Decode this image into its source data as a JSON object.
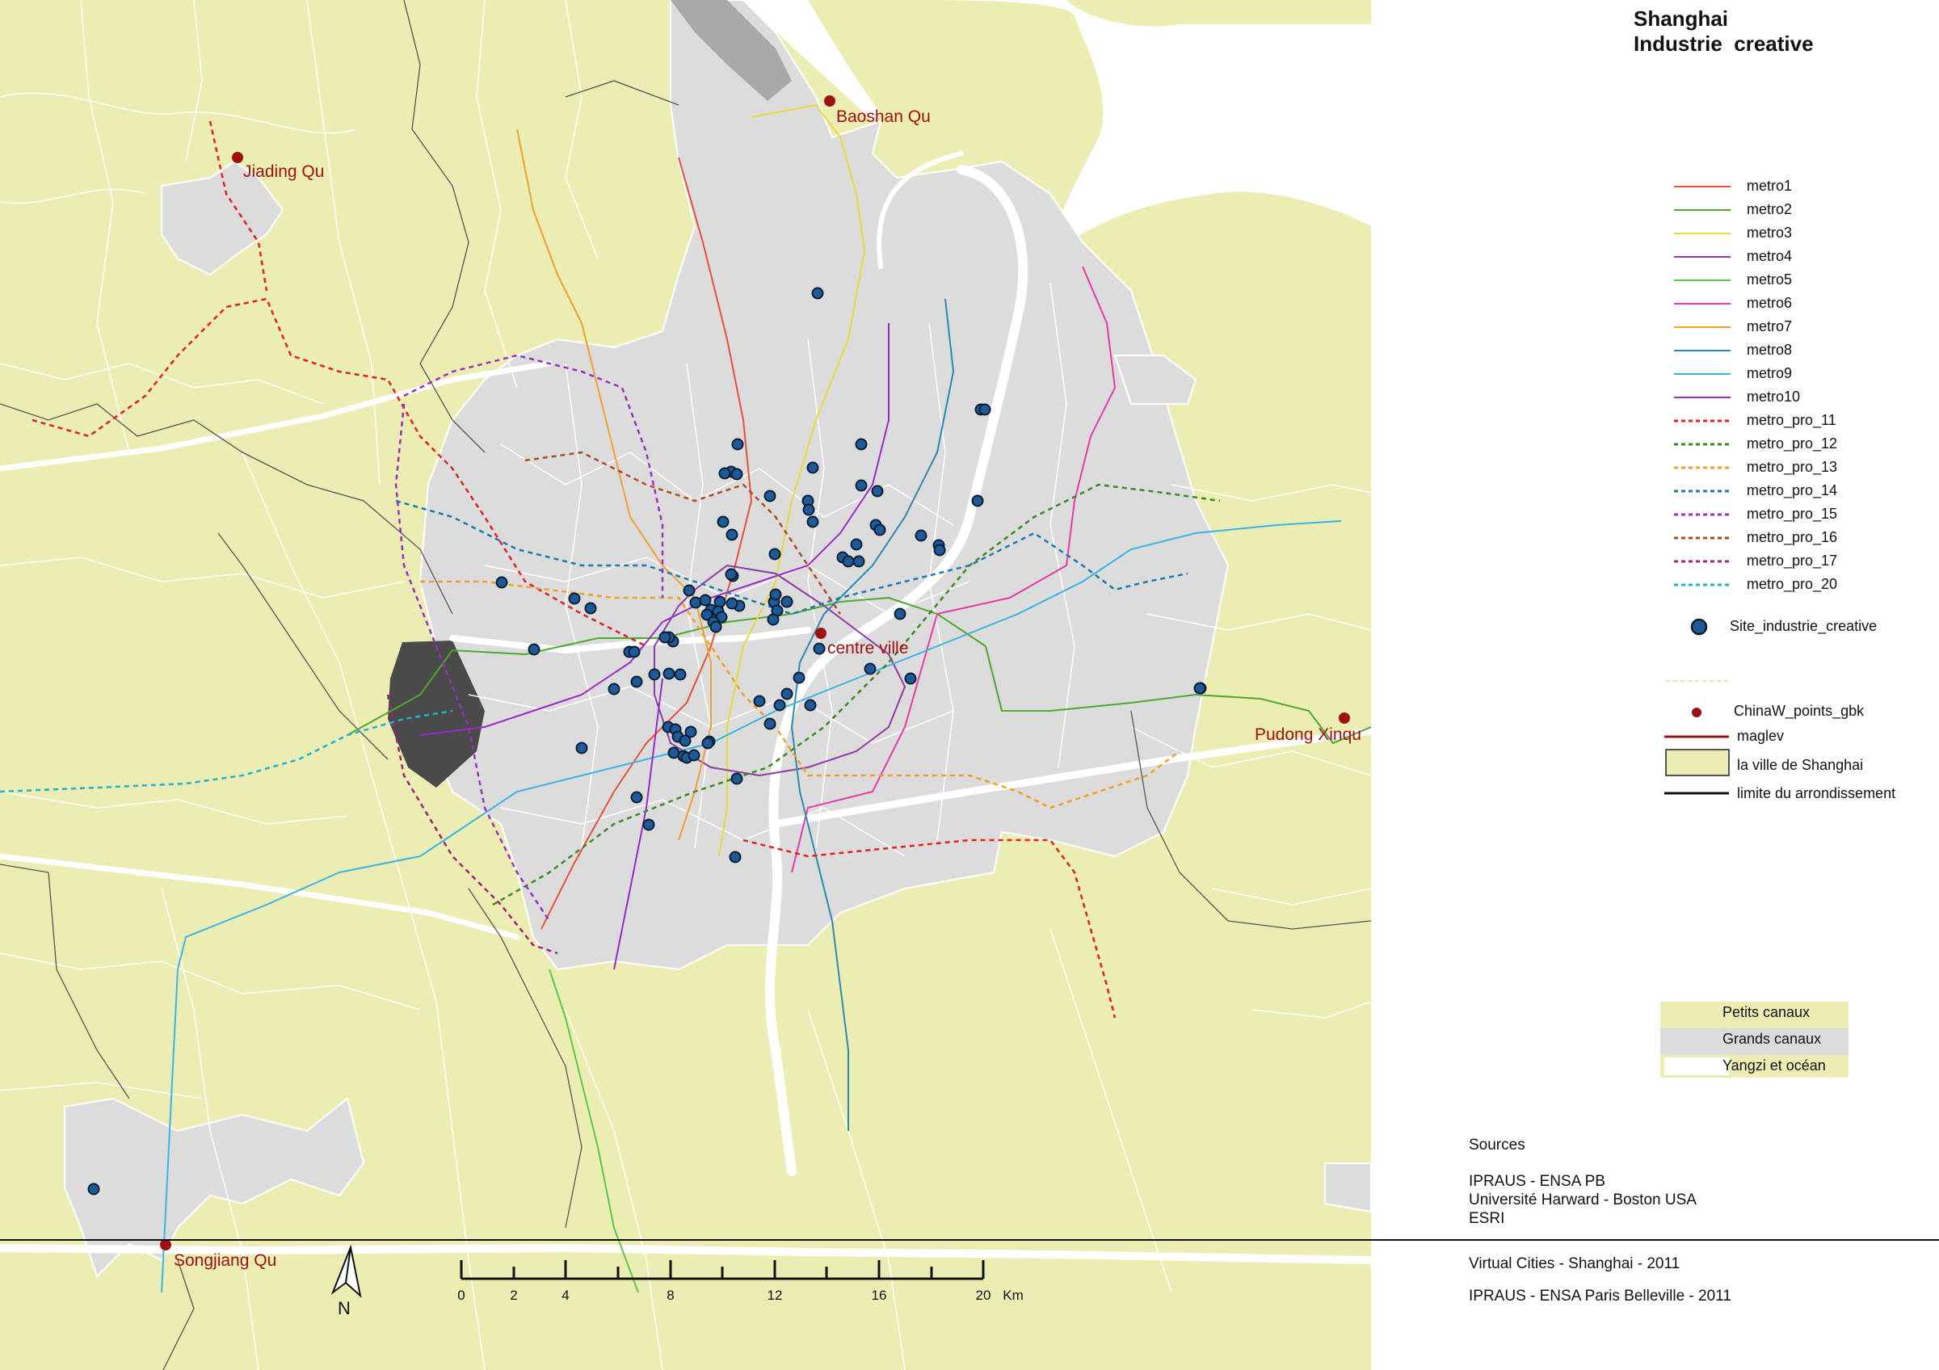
{
  "title": {
    "line1": "Shanghai",
    "line2": "Industrie  creative"
  },
  "places": [
    {
      "name": "Jiading Qu"
    },
    {
      "name": "Baoshan Qu"
    },
    {
      "name": "centre ville"
    },
    {
      "name": "Pudong Xinqu"
    },
    {
      "name": "Songjiang Qu"
    }
  ],
  "legend": {
    "lines": [
      {
        "label": "metro1",
        "color": "#e8503a",
        "dashed": false
      },
      {
        "label": "metro2",
        "color": "#4ea82e",
        "dashed": false
      },
      {
        "label": "metro3",
        "color": "#e6dc3a",
        "dashed": false
      },
      {
        "label": "metro4",
        "color": "#8b3aa8",
        "dashed": false
      },
      {
        "label": "metro5",
        "color": "#5cc84a",
        "dashed": false
      },
      {
        "label": "metro6",
        "color": "#e63aa8",
        "dashed": false
      },
      {
        "label": "metro7",
        "color": "#f0a030",
        "dashed": false
      },
      {
        "label": "metro8",
        "color": "#2a8ab0",
        "dashed": false
      },
      {
        "label": "metro9",
        "color": "#3ab4e6",
        "dashed": false
      },
      {
        "label": "metro10",
        "color": "#9a2ac8",
        "dashed": false
      },
      {
        "label": "metro_pro_11",
        "color": "#e02020",
        "dashed": true
      },
      {
        "label": "metro_pro_12",
        "color": "#3a8a20",
        "dashed": true
      },
      {
        "label": "metro_pro_13",
        "color": "#f0a020",
        "dashed": true
      },
      {
        "label": "metro_pro_14",
        "color": "#1a7ab0",
        "dashed": true
      },
      {
        "label": "metro_pro_15",
        "color": "#9a30c0",
        "dashed": true
      },
      {
        "label": "metro_pro_16",
        "color": "#b04a20",
        "dashed": true
      },
      {
        "label": "metro_pro_17",
        "color": "#a0207a",
        "dashed": true
      },
      {
        "label": "metro_pro_20",
        "color": "#20b0d0",
        "dashed": true
      }
    ],
    "site_label": "Site_industrie_creative",
    "points_label": "ChinaW_points_gbk",
    "maglev_label": "maglev",
    "city_label": "la ville de Shanghai",
    "border_label": "limite du arrondissement",
    "canals": [
      {
        "label": "Petits canaux"
      },
      {
        "label": "Grands canaux"
      },
      {
        "label": "Yangzi et océan"
      }
    ]
  },
  "sources": {
    "heading": "Sources",
    "lines": [
      "IPRAUS - ENSA PB",
      "Université Harward - Boston USA",
      "ESRI"
    ]
  },
  "credits": [
    "Virtual Cities - Shanghai - 2011",
    "IPRAUS - ENSA Paris Belleville - 2011"
  ],
  "scale": {
    "ticks": [
      "0",
      "2",
      "4",
      "8",
      "12",
      "16",
      "20"
    ],
    "unit": "Km"
  },
  "north": "N",
  "colors": {
    "land": "#ecedb3",
    "urban": "#dcdcdc",
    "water": "#ffffff",
    "site": "#1e5a9a",
    "place": "#a01010"
  }
}
